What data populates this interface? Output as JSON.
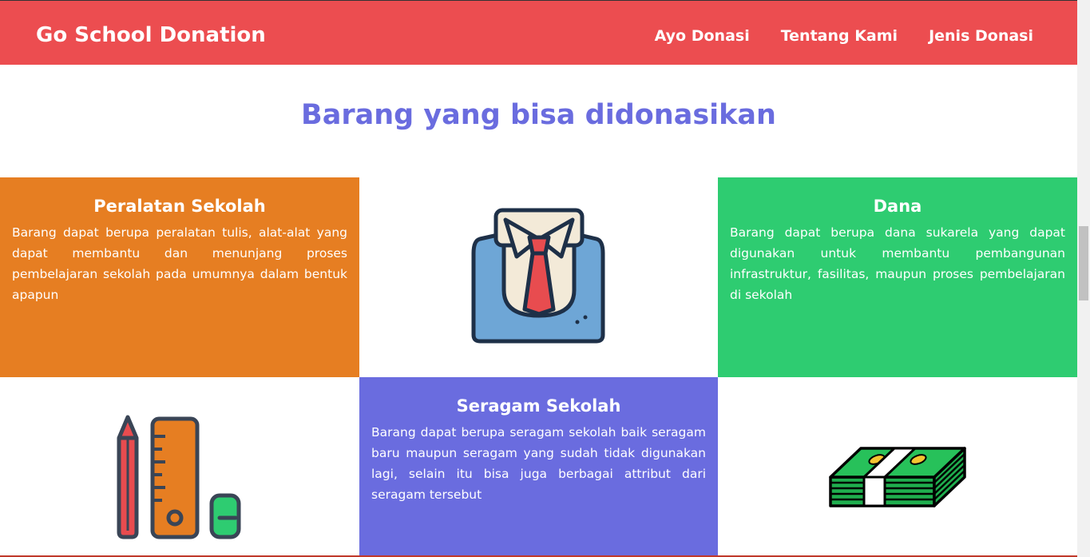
{
  "navbar": {
    "brand": "Go School Donation",
    "links": [
      "Ayo Donasi",
      "Tentang Kami",
      "Jenis Donasi"
    ]
  },
  "section": {
    "title": "Barang yang bisa didonasikan"
  },
  "cards": {
    "peralatan": {
      "title": "Peralatan Sekolah",
      "description": "Barang dapat berupa peralatan tulis, alat-alat yang dapat membantu dan menunjang proses pembelajaran sekolah pada umumnya dalam bentuk apapun"
    },
    "dana": {
      "title": "Dana",
      "description": "Barang dapat berupa dana sukarela yang dapat digunakan untuk membantu pembangunan infrastruktur, fasilitas, maupun proses pembelajaran di sekolah"
    },
    "seragam": {
      "title": "Seragam Sekolah",
      "description": "Barang dapat berupa seragam sekolah baik seragam baru maupun seragam yang sudah tidak digunakan lagi, selain itu bisa juga berbagai attribut dari seragam tersebut"
    }
  },
  "icons": {
    "uniform": "shirt-tie-icon",
    "stationery": "pencil-ruler-eraser-icon",
    "money": "money-stack-icon"
  },
  "colors": {
    "navbar": "#ec4d50",
    "title": "#6a6cdf",
    "orange": "#e67e22",
    "green": "#2ecc71",
    "purple": "#6a6cdf"
  }
}
